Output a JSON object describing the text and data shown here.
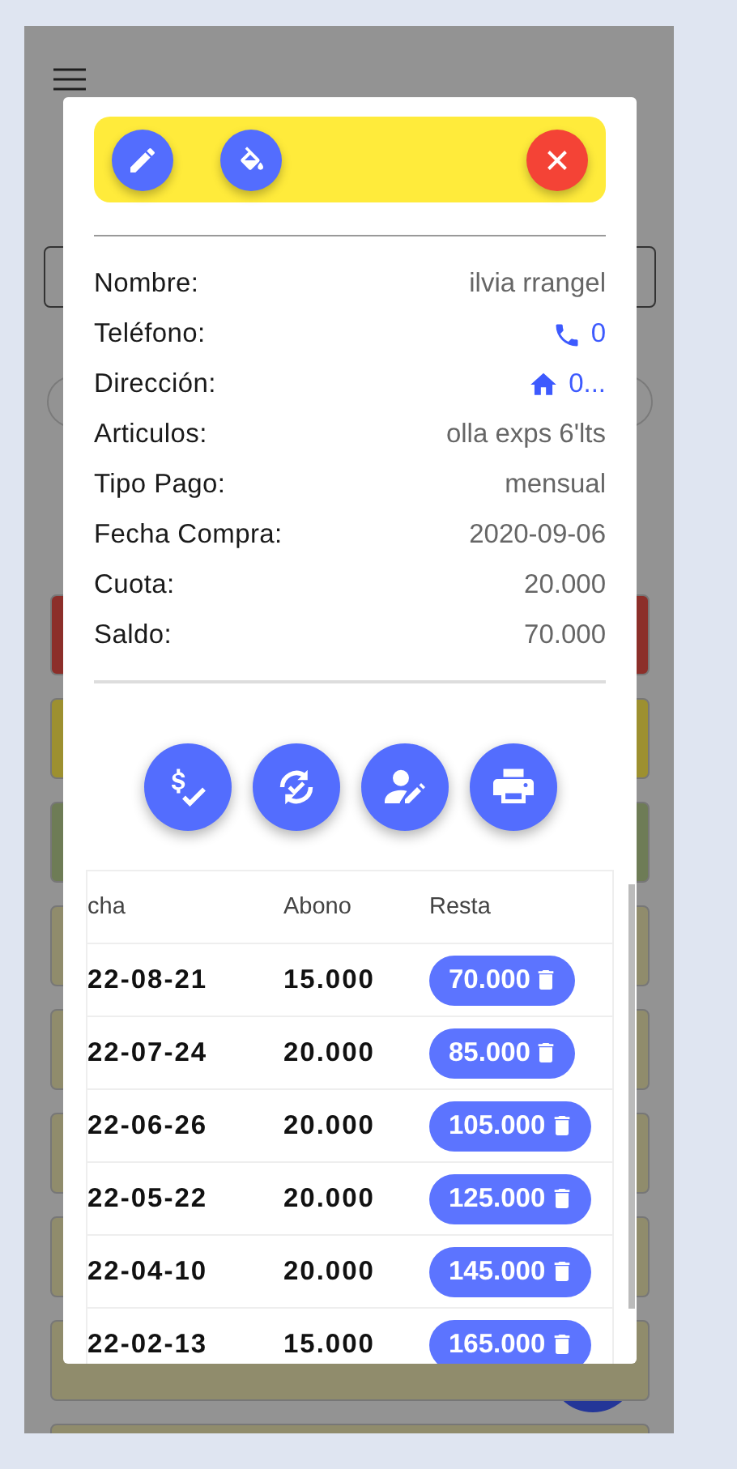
{
  "background": {
    "cards": [
      {
        "color": "#8c2f2a"
      },
      {
        "color": "#9d9030"
      },
      {
        "color": "#6e7c56"
      },
      {
        "color": "#908c6c"
      },
      {
        "color": "#908c6c"
      },
      {
        "color": "#908c6c"
      },
      {
        "color": "#908c6c"
      },
      {
        "color": "#908c6c"
      },
      {
        "color": "#908c6c"
      }
    ]
  },
  "dialog": {
    "details": [
      {
        "label": "Nombre:",
        "value": "ilvia rrangel",
        "kind": "text"
      },
      {
        "label": "Teléfono:",
        "value": "0",
        "kind": "phone"
      },
      {
        "label": "Dirección:",
        "value": "0...",
        "kind": "address"
      },
      {
        "label": "Articulos:",
        "value": "olla exps 6'lts",
        "kind": "text"
      },
      {
        "label": "Tipo Pago:",
        "value": "mensual",
        "kind": "text"
      },
      {
        "label": "Fecha Compra:",
        "value": "2020-09-06",
        "kind": "text"
      },
      {
        "label": "Cuota:",
        "value": "20.000",
        "kind": "text"
      },
      {
        "label": "Saldo:",
        "value": "70.000",
        "kind": "text"
      }
    ],
    "table": {
      "columns": [
        "cha",
        "Abono",
        "Resta"
      ],
      "rows": [
        {
          "date": "22-08-21",
          "abono": "15.000",
          "resta": "70.000"
        },
        {
          "date": "22-07-24",
          "abono": "20.000",
          "resta": "85.000"
        },
        {
          "date": "22-06-26",
          "abono": "20.000",
          "resta": "105.000"
        },
        {
          "date": "22-05-22",
          "abono": "20.000",
          "resta": "125.000"
        },
        {
          "date": "22-04-10",
          "abono": "20.000",
          "resta": "145.000"
        },
        {
          "date": "22-02-13",
          "abono": "15.000",
          "resta": "165.000"
        }
      ]
    }
  }
}
